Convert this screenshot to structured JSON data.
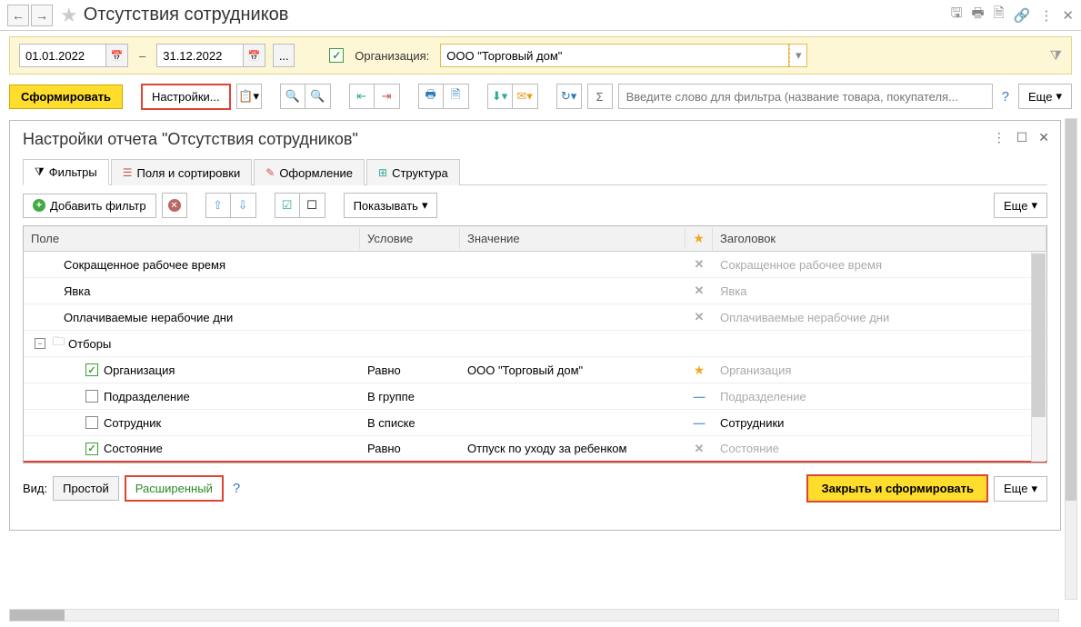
{
  "title": "Отсутствия сотрудников",
  "params": {
    "date_from": "01.01.2022",
    "date_to": "31.12.2022",
    "org_label": "Организация:",
    "org_value": "ООО \"Торговый дом\""
  },
  "toolbar": {
    "generate": "Сформировать",
    "settings": "Настройки...",
    "show": "Показывать",
    "more": "Еще",
    "search_placeholder": "Введите слово для фильтра (название товара, покупателя..."
  },
  "dialog": {
    "title": "Настройки отчета \"Отсутствия сотрудников\"",
    "tabs": {
      "filters": "Фильтры",
      "fields": "Поля и сортировки",
      "format": "Оформление",
      "structure": "Структура"
    },
    "add_filter": "Добавить фильтр",
    "show_btn": "Показывать",
    "more": "Еще",
    "columns": {
      "field": "Поле",
      "cond": "Условие",
      "value": "Значение",
      "header": "Заголовок"
    },
    "rows": [
      {
        "type": "plain",
        "field": "Сокращенное рабочее время",
        "star": "x",
        "header": "Сокращенное рабочее время"
      },
      {
        "type": "plain",
        "field": "Явка",
        "star": "x",
        "header": "Явка"
      },
      {
        "type": "plain",
        "field": "Оплачиваемые нерабочие дни",
        "star": "x",
        "header": "Оплачиваемые нерабочие дни"
      },
      {
        "type": "group",
        "field": "Отборы"
      },
      {
        "type": "filter",
        "checked": true,
        "field": "Организация",
        "cond": "Равно",
        "value": "ООО \"Торговый дом\"",
        "star": "star",
        "header": "Организация",
        "hgrey": true
      },
      {
        "type": "filter",
        "checked": false,
        "field": "Подразделение",
        "cond": "В группе",
        "value": "",
        "star": "dash",
        "header": "Подразделение",
        "hgrey": true
      },
      {
        "type": "filter",
        "checked": false,
        "field": "Сотрудник",
        "cond": "В списке",
        "value": "",
        "star": "dash",
        "header": "Сотрудники",
        "hgrey": false
      },
      {
        "type": "filter",
        "checked": true,
        "field": "Состояние",
        "cond": "Равно",
        "value": "Отпуск по уходу за ребенком",
        "star": "x",
        "header": "Состояние",
        "hgrey": true,
        "underline": true
      }
    ],
    "view_label": "Вид:",
    "view_simple": "Простой",
    "view_advanced": "Расширенный",
    "close_generate": "Закрыть и сформировать",
    "more2": "Еще"
  }
}
